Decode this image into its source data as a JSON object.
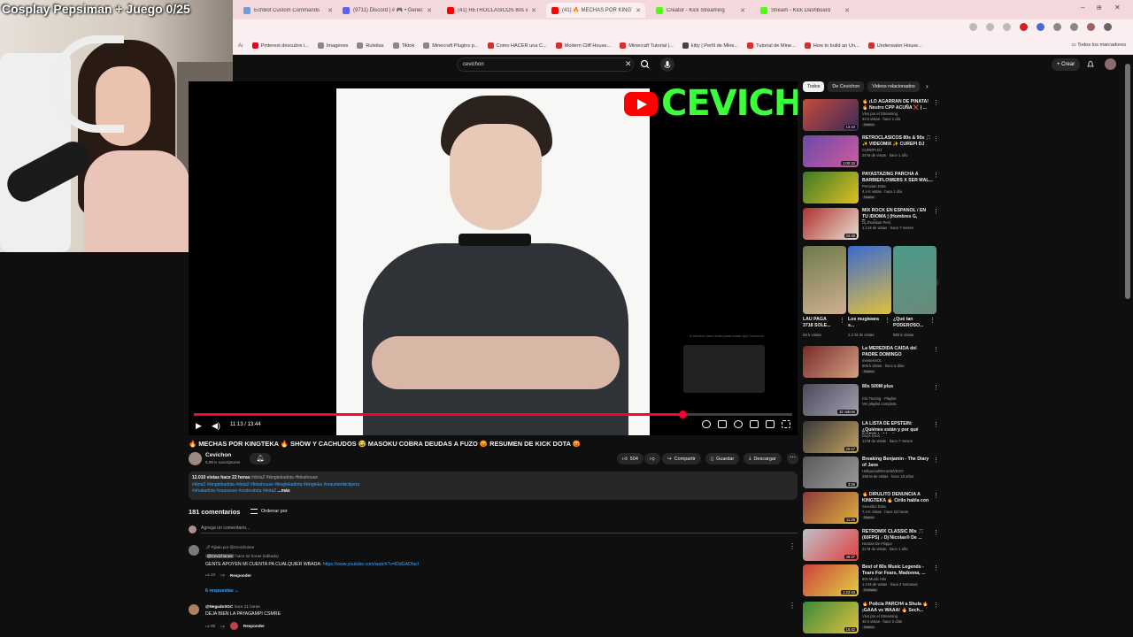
{
  "stream_overlay": {
    "title": "Cosplay Pepsiman + Juego 0/25"
  },
  "browser": {
    "tabs": [
      {
        "label": "EchBot Custom Commands",
        "active": false,
        "color": "#6f9cd6"
      },
      {
        "label": "(9711) Discord | # 🎮 • Generz",
        "active": false,
        "color": "#5865f2"
      },
      {
        "label": "(41) RETROCLASICOS 80s & 90s",
        "active": false,
        "color": "#ff0000"
      },
      {
        "label": "(41) 🔥 MECHAS POR KINGTEK",
        "active": true,
        "color": "#ff0000"
      },
      {
        "label": "Creator - Kick Streaming",
        "active": false,
        "color": "#53fc18"
      },
      {
        "label": "Stream - Kick Dashboard",
        "active": false,
        "color": "#53fc18"
      }
    ],
    "bookmarks": [
      "Pinterest descubre i...",
      "Imagenes",
      "Ruleitas",
      "Tiktok",
      "Minecraft Plugins p...",
      "Como HACER una C...",
      "Modern Cliff House...",
      "Minecraft Tutorial |...",
      "kitty | Perfil de Mine...",
      "Tutorial de Mine...",
      "How to build an Un...",
      "Underwater House..."
    ],
    "bookmarks_folder": "Todos los marcadores"
  },
  "youtube": {
    "search_value": "cevichon",
    "create_label": "Crear",
    "player": {
      "time": "11:13 / 13:44",
      "progress": 0.817,
      "logo_text": "CEVICHON",
      "end_note": "5 minutos hace antes para editar que Cevichon"
    },
    "video": {
      "title": "🔥 MECHAS POR KINGTEKA 🔥 SHOW Y CACHUDOS 😂 MASOKU COBRA DEUDAS A FUZO 😡 RESUMEN DE KICK DOTA 😡",
      "channel": "Cevichon",
      "subs": "6,99 K suscriptores",
      "likes": "504",
      "share": "Compartir",
      "save": "Guardar",
      "download": "Descargar"
    },
    "description": {
      "meta": "12.010 vistas  hace 22 horas",
      "meta_tags": " #dota2 #kingtekadota #fekahouse",
      "tags_line1": "#dota2 #kingtekadota #dota2 #fekahouse #kingtekadota #kingteka #resumenkickperu",
      "tags_line2": "#shakadota #zuasesso #sodevdota #dota2",
      "more": "...más"
    },
    "comments": {
      "count": "181 comentarios",
      "sort": "Ordenar por",
      "add_placeholder": "Agrega un comentario...",
      "items": [
        {
          "pinned": "Fijado por @Cevichonee",
          "author": "@Cevichonee",
          "meta": "hace 22 horas (editado)",
          "text": "GENTE APOYEN MI CUENTA PA CUALQUIER WBADA: ",
          "link": "https://www.youtube.com/watch?v=lDdGADfacI",
          "likes": "24",
          "reply": "Responder",
          "replies": "6 respuestas"
        },
        {
          "author": "@NegadoSGC",
          "meta": "hace 21 horas",
          "text": "DEJA BIEN LA PAYAGAMPI CSMRE",
          "likes": "80",
          "reply": "Responder"
        }
      ]
    },
    "sidebar": {
      "chips": [
        "Todos",
        "De Cevichon",
        "Videos relacionados"
      ],
      "top_recs": [
        {
          "title": "🔥 ¡LO AGARRAN DE PIÑATA! 🔥 Neutro CPP ACUÑA ❌ | ...",
          "channel": "Vivo por el Streaming",
          "meta": "43 k vistas · hace 1 día",
          "badge": "Nuevo",
          "duration": "13:23",
          "c1": "#c84a3b",
          "c2": "#3a2a5a"
        },
        {
          "title": "RETROCLASICOS 80s & 90s 🎵 ✨ VIDEOMIX ✨ CUREPI DJ",
          "channel": "CUREPI DJ",
          "meta": "28 M de vistas · hace 1 año",
          "badge": "",
          "duration": "1:00:33",
          "c1": "#6a4aa8",
          "c2": "#d05aa0"
        },
        {
          "title": "PAYASTAZING PARCHA A BARBIEFLOWERS X SER MAL...",
          "channel": "Peruvian Dota",
          "meta": "4.4 K vistas · hace 1 día",
          "badge": "Nuevo",
          "duration": "",
          "c1": "#3a7a2a",
          "c2": "#e0c020"
        },
        {
          "title": "MIX ROCK EN ESPAÑOL / EN TU IDIOMA | (Hombres G, Enanito...",
          "channel": "Dj Jhonatan Perú",
          "meta": "1.3 M de vistas · hace 7 meses",
          "badge": "",
          "duration": "34:48",
          "c1": "#b03030",
          "c2": "#e8e0d0"
        }
      ],
      "shorts": [
        {
          "title": "LAU PAGA 3718 SOLE...",
          "views": "55 k vistas",
          "c1": "#6d7a4a",
          "c2": "#d0b090"
        },
        {
          "title": "Los mugiwara s...",
          "views": "2.2 M de vistas",
          "c1": "#3a6ad0",
          "c2": "#e0c040"
        },
        {
          "title": "¿Qué tan PODEROSO...",
          "views": "883 k vistas",
          "c1": "#4a9a8a",
          "c2": "#6a8a7a"
        }
      ],
      "bottom_recs": [
        {
          "title": "La MEREDIDA CAÍDA del PADRE DOMINGO",
          "channel": "mentesrv01",
          "meta": "605 k vistas · hace 5 días",
          "badge": "Nuevo",
          "duration": "",
          "c1": "#7a2a2a",
          "c2": "#d0a080"
        },
        {
          "title": "80s 500M plus",
          "channel": "Chi Trương · Playlist",
          "meta": "Ver playlist completa",
          "badge": "",
          "duration": "32 videos",
          "c1": "#4a4a5a",
          "c2": "#a0a0b0"
        },
        {
          "title": "LA LISTA DE EPSTEIN: ¿Quiénes están y por qué NADIE habla d...",
          "channel": "Dock Docs",
          "meta": "13 M de vistas · hace 7 meses",
          "badge": "",
          "duration": "20:17",
          "c1": "#3a3a3a",
          "c2": "#c0a060"
        },
        {
          "title": "Breaking Benjamin - The Diary of Jane",
          "channel": "HollywoodRecordsVEVO",
          "meta": "295 M de vistas · hace 16 años",
          "badge": "",
          "duration": "3:26",
          "c1": "#5a5a5a",
          "c2": "#9a9a9a"
        },
        {
          "title": "🔥 DIRULITO DENUNCIA A KINGTEKA 🔥 Cirilo habla con ...",
          "channel": "Sexodeo Dota",
          "meta": "7.4 K vistas · hace 22 horas",
          "badge": "Nuevo",
          "duration": "11:26",
          "c1": "#8a3a3a",
          "c2": "#e0b040"
        },
        {
          "title": "RETROMIX CLASSIC 80s 🎵 (60FPS) ♪ Dj Nicolas® De ...",
          "channel": "Nicolas De Filippo",
          "meta": "22 M de vistas · hace 1 año",
          "badge": "",
          "duration": "49:27",
          "c1": "#c0c0c8",
          "c2": "#e04040"
        },
        {
          "title": "Best of 80s Music Legends - Tears For Fears, Madonna, ...",
          "channel": "80s Music Hits",
          "meta": "1.4 M de vistas · hace 2 semanas",
          "badge": "Doblado",
          "duration": "1:23:43",
          "c1": "#d04040",
          "c2": "#e0d040"
        },
        {
          "title": "🔥 Policía PARCH4 a Shula 🔥 ¡GAAA vs WAAA! 🔥 Sech...",
          "channel": "Vivo por el Streaming",
          "meta": "45 k vistas · hace 2 días",
          "badge": "Nuevo",
          "duration": "15:42",
          "c1": "#3a8a3a",
          "c2": "#e0c040"
        }
      ]
    }
  },
  "colors": {
    "yt_red": "#ff0033",
    "kick_green": "#53fc18",
    "link_blue": "#3ea6ff"
  }
}
